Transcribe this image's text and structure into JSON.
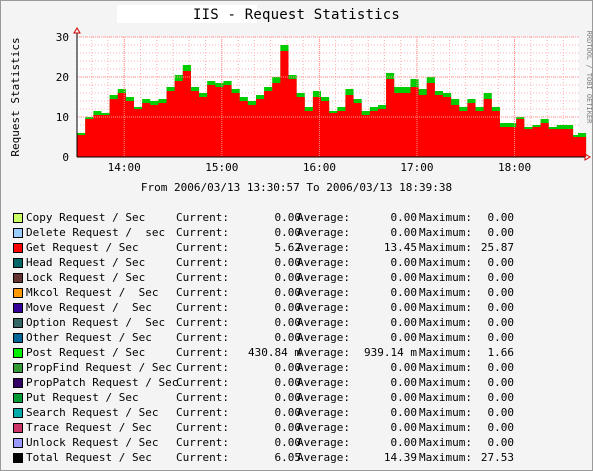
{
  "window": {
    "title": "IIS - Request Statistics",
    "watermark": "RRDTOOL / TOBI OETIKER",
    "time_range_label": "From 2006/03/13 13:30:57 To 2006/03/13 18:39:38"
  },
  "chart_data": {
    "type": "area",
    "title": "IIS - Request Statistics",
    "ylabel": "Request Statistics",
    "xlabel": "",
    "ylim": [
      0,
      30
    ],
    "y_ticks": [
      0,
      10,
      20,
      30
    ],
    "x_ticks": [
      "14:00",
      "15:00",
      "16:00",
      "17:00",
      "18:00"
    ],
    "x_tick_minutes": [
      840,
      900,
      960,
      1020,
      1080
    ],
    "x_range_minutes": [
      810.95,
      1119.63
    ],
    "grid": true,
    "colors": {
      "get": "#ff0000",
      "total": "#00cc00",
      "grid_major": "#ff9090",
      "grid_minor": "#ffb0b0",
      "plot_bg": "#ffffff"
    },
    "series": [
      {
        "name": "Get Request / Sec",
        "color": "#ff0000",
        "x_minutes": [
          811,
          816,
          821,
          826,
          831,
          836,
          841,
          846,
          851,
          856,
          861,
          866,
          871,
          876,
          881,
          886,
          891,
          896,
          901,
          906,
          911,
          916,
          921,
          926,
          931,
          936,
          941,
          946,
          951,
          956,
          961,
          966,
          971,
          976,
          981,
          986,
          991,
          996,
          1001,
          1006,
          1011,
          1016,
          1021,
          1026,
          1031,
          1036,
          1041,
          1046,
          1051,
          1056,
          1061,
          1066,
          1071,
          1076,
          1081,
          1086,
          1091,
          1096,
          1101,
          1106,
          1111,
          1116,
          1119
        ],
        "values": [
          5.5,
          9.5,
          10.5,
          10.5,
          14.5,
          16.0,
          14.0,
          12.0,
          13.5,
          13.0,
          13.5,
          16.5,
          19.0,
          21.5,
          16.5,
          15.0,
          18.0,
          17.5,
          18.0,
          16.0,
          14.0,
          13.0,
          14.5,
          16.5,
          18.5,
          26.5,
          19.5,
          15.0,
          11.5,
          15.0,
          14.0,
          11.0,
          11.5,
          15.5,
          13.5,
          10.5,
          11.5,
          12.0,
          19.5,
          16.0,
          16.0,
          17.5,
          15.5,
          18.5,
          15.5,
          15.0,
          13.0,
          11.5,
          13.5,
          11.5,
          14.5,
          11.5,
          7.5,
          7.5,
          9.5,
          7.0,
          7.5,
          8.5,
          7.0,
          7.0,
          7.0,
          5.0,
          5.0
        ]
      },
      {
        "name": "Total Request / Sec",
        "color": "#00cc00",
        "x_minutes": [
          811,
          816,
          821,
          826,
          831,
          836,
          841,
          846,
          851,
          856,
          861,
          866,
          871,
          876,
          881,
          886,
          891,
          896,
          901,
          906,
          911,
          916,
          921,
          926,
          931,
          936,
          941,
          946,
          951,
          956,
          961,
          966,
          971,
          976,
          981,
          986,
          991,
          996,
          1001,
          1006,
          1011,
          1016,
          1021,
          1026,
          1031,
          1036,
          1041,
          1046,
          1051,
          1056,
          1061,
          1066,
          1071,
          1076,
          1081,
          1086,
          1091,
          1096,
          1101,
          1106,
          1111,
          1116,
          1119
        ],
        "values": [
          6.0,
          10.0,
          11.5,
          11.0,
          15.5,
          17.0,
          15.0,
          12.5,
          14.5,
          14.0,
          14.5,
          17.5,
          20.5,
          23.0,
          17.5,
          16.0,
          19.0,
          18.5,
          19.0,
          17.0,
          15.0,
          14.0,
          15.5,
          17.5,
          20.0,
          28.0,
          20.5,
          16.0,
          12.5,
          16.5,
          15.0,
          11.5,
          12.5,
          17.0,
          14.5,
          11.5,
          12.5,
          13.0,
          21.0,
          17.5,
          17.5,
          19.5,
          17.0,
          20.0,
          16.5,
          16.0,
          14.5,
          12.5,
          14.5,
          12.5,
          16.0,
          12.5,
          8.5,
          8.5,
          10.0,
          7.5,
          8.0,
          9.5,
          7.5,
          8.0,
          8.0,
          5.5,
          6.0
        ]
      }
    ]
  },
  "legend": [
    {
      "name": "Copy Request / Sec",
      "color": "#ccff66",
      "current_label": "Current:",
      "current": "0.00",
      "average_label": "Average:",
      "average": "0.00",
      "maximum_label": "Maximum:",
      "maximum": "0.00"
    },
    {
      "name": "Delete Request /  sec",
      "color": "#99ccff",
      "current_label": "Current:",
      "current": "0.00",
      "average_label": "Average:",
      "average": "0.00",
      "maximum_label": "Maximum:",
      "maximum": "0.00"
    },
    {
      "name": "Get Request / Sec",
      "color": "#ff0000",
      "current_label": "Current:",
      "current": "5.62",
      "average_label": "Average:",
      "average": "13.45",
      "maximum_label": "Maximum:",
      "maximum": "25.87"
    },
    {
      "name": "Head Request / Sec",
      "color": "#006666",
      "current_label": "Current:",
      "current": "0.00",
      "average_label": "Average:",
      "average": "0.00",
      "maximum_label": "Maximum:",
      "maximum": "0.00"
    },
    {
      "name": "Lock Request / Sec",
      "color": "#663333",
      "current_label": "Current:",
      "current": "0.00",
      "average_label": "Average:",
      "average": "0.00",
      "maximum_label": "Maximum:",
      "maximum": "0.00"
    },
    {
      "name": "Mkcol Request /  Sec",
      "color": "#ff9900",
      "current_label": "Current:",
      "current": "0.00",
      "average_label": "Average:",
      "average": "0.00",
      "maximum_label": "Maximum:",
      "maximum": "0.00"
    },
    {
      "name": "Move Request /  Sec",
      "color": "#330099",
      "current_label": "Current:",
      "current": "0.00",
      "average_label": "Average:",
      "average": "0.00",
      "maximum_label": "Maximum:",
      "maximum": "0.00"
    },
    {
      "name": "Option Request /  Sec",
      "color": "#336666",
      "current_label": "Current:",
      "current": "0.00",
      "average_label": "Average:",
      "average": "0.00",
      "maximum_label": "Maximum:",
      "maximum": "0.00"
    },
    {
      "name": "Other Request / Sec",
      "color": "#006699",
      "current_label": "Current:",
      "current": "0.00",
      "average_label": "Average:",
      "average": "0.00",
      "maximum_label": "Maximum:",
      "maximum": "0.00"
    },
    {
      "name": "Post Request / Sec",
      "color": "#00ee00",
      "current_label": "Current:",
      "current": "430.84 m",
      "average_label": "Average:",
      "average": "939.14 m",
      "maximum_label": "Maximum:",
      "maximum": "1.66"
    },
    {
      "name": "PropFind Request / Sec",
      "color": "#339933",
      "current_label": "Current:",
      "current": "0.00",
      "average_label": "Average:",
      "average": "0.00",
      "maximum_label": "Maximum:",
      "maximum": "0.00"
    },
    {
      "name": "PropPatch Request / Sec",
      "color": "#330066",
      "current_label": "Current:",
      "current": "0.00",
      "average_label": "Average:",
      "average": "0.00",
      "maximum_label": "Maximum:",
      "maximum": "0.00"
    },
    {
      "name": "Put Request / Sec",
      "color": "#009933",
      "current_label": "Current:",
      "current": "0.00",
      "average_label": "Average:",
      "average": "0.00",
      "maximum_label": "Maximum:",
      "maximum": "0.00"
    },
    {
      "name": "Search Request / Sec",
      "color": "#00aaaa",
      "current_label": "Current:",
      "current": "0.00",
      "average_label": "Average:",
      "average": "0.00",
      "maximum_label": "Maximum:",
      "maximum": "0.00"
    },
    {
      "name": "Trace Request / Sec",
      "color": "#cc3366",
      "current_label": "Current:",
      "current": "0.00",
      "average_label": "Average:",
      "average": "0.00",
      "maximum_label": "Maximum:",
      "maximum": "0.00"
    },
    {
      "name": "Unlock Request / Sec",
      "color": "#9999ff",
      "current_label": "Current:",
      "current": "0.00",
      "average_label": "Average:",
      "average": "0.00",
      "maximum_label": "Maximum:",
      "maximum": "0.00"
    },
    {
      "name": "Total Request / Sec",
      "color": "#000000",
      "current_label": "Current:",
      "current": "6.05",
      "average_label": "Average:",
      "average": "14.39",
      "maximum_label": "Maximum:",
      "maximum": "27.53"
    }
  ]
}
